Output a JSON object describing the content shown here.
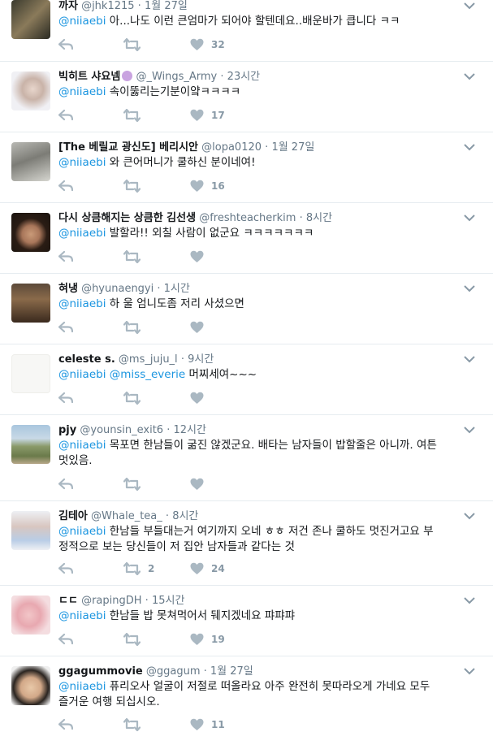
{
  "colors": {
    "link": "#1b95e0",
    "meta": "#657786",
    "icon": "#aab8c2",
    "divider": "#e6ecf0"
  },
  "tweets": [
    {
      "name": "까자",
      "handle": "@jhk1215",
      "dot": "·",
      "time": "1월 27일",
      "mentions": [
        "@niiaebi"
      ],
      "text": "아...나도 이런 큰엄마가 되어야 할텐데요..배운바가 큽니다 ㅋㅋ",
      "text2": "",
      "retweets": "",
      "likes": "32"
    },
    {
      "name": "빅히트 샤요넴",
      "handle": "@_Wings_Army",
      "dot": "·",
      "time": "23시간",
      "mentions": [
        "@niiaebi"
      ],
      "text": "속이뚫리는기분이얔ㅋㅋㅋㅋ",
      "text2": "",
      "retweets": "",
      "likes": "17"
    },
    {
      "name": "[The 베릴교 광신도] 베리시안",
      "handle": "@lopa0120",
      "dot": "·",
      "time": "1월 27일",
      "mentions": [
        "@niiaebi"
      ],
      "text": "와 큰어머니가 쿨하신 분이네여!",
      "text2": "",
      "retweets": "",
      "likes": "16"
    },
    {
      "name": "다시 상큼해지는 상큼한 김선생",
      "handle": "@freshteacherkim",
      "dot": "·",
      "time": "8시간",
      "mentions": [
        "@niiaebi"
      ],
      "text": "발할라!! 외칠 사람이 없군요 ㅋㅋㅋㅋㅋㅋㅋ",
      "text2": "",
      "retweets": "",
      "likes": ""
    },
    {
      "name": "혀냉",
      "handle": "@hyunaengyi",
      "dot": "·",
      "time": "1시간",
      "mentions": [
        "@niiaebi"
      ],
      "text": "하 울 엄니도좀 저리 사셨으면",
      "text2": "",
      "retweets": "",
      "likes": ""
    },
    {
      "name": "celeste s.",
      "handle": "@ms_juju_l",
      "dot": "·",
      "time": "9시간",
      "mentions": [
        "@niiaebi",
        "@miss_everie"
      ],
      "text": "머찌세여~~~",
      "text2": "",
      "retweets": "",
      "likes": ""
    },
    {
      "name": "pjy",
      "handle": "@younsin_exit6",
      "dot": "·",
      "time": "12시간",
      "mentions": [
        "@niiaebi"
      ],
      "text": "목포면 한남들이 굶진 않겠군요. 배타는 남자들이 밥할줄은 아니까. 여튼",
      "text2": "멋있음.",
      "retweets": "",
      "likes": ""
    },
    {
      "name": "김테아",
      "handle": "@Whale_tea_",
      "dot": "·",
      "time": "8시간",
      "mentions": [
        "@niiaebi"
      ],
      "text": "한남들 부들대는거 여기까지 오네 ㅎㅎ 저건 존나 쿨하도 멋진거고요 부",
      "text2": "정적으로 보는 당신들이 저 집안 남자들과 같다는 것",
      "retweets": "2",
      "likes": "24"
    },
    {
      "name": "ㄷㄷ",
      "handle": "@rapingDH",
      "dot": "·",
      "time": "15시간",
      "mentions": [
        "@niiaebi"
      ],
      "text": "한남들 밥 못쳐먹어서 뒈지겠네요 퍄퍄퍄",
      "text2": "",
      "retweets": "",
      "likes": "19"
    },
    {
      "name": "ggagummovie",
      "handle": "@ggagum",
      "dot": "·",
      "time": "1월 27일",
      "mentions": [
        "@niiaebi"
      ],
      "text": "퓨리오사 얼굴이 저절로 떠올라요 아주 완전히 못따라오게 가네요 모두",
      "text2": "즐거운 여행 되십시오.",
      "retweets": "",
      "likes": "11"
    }
  ]
}
